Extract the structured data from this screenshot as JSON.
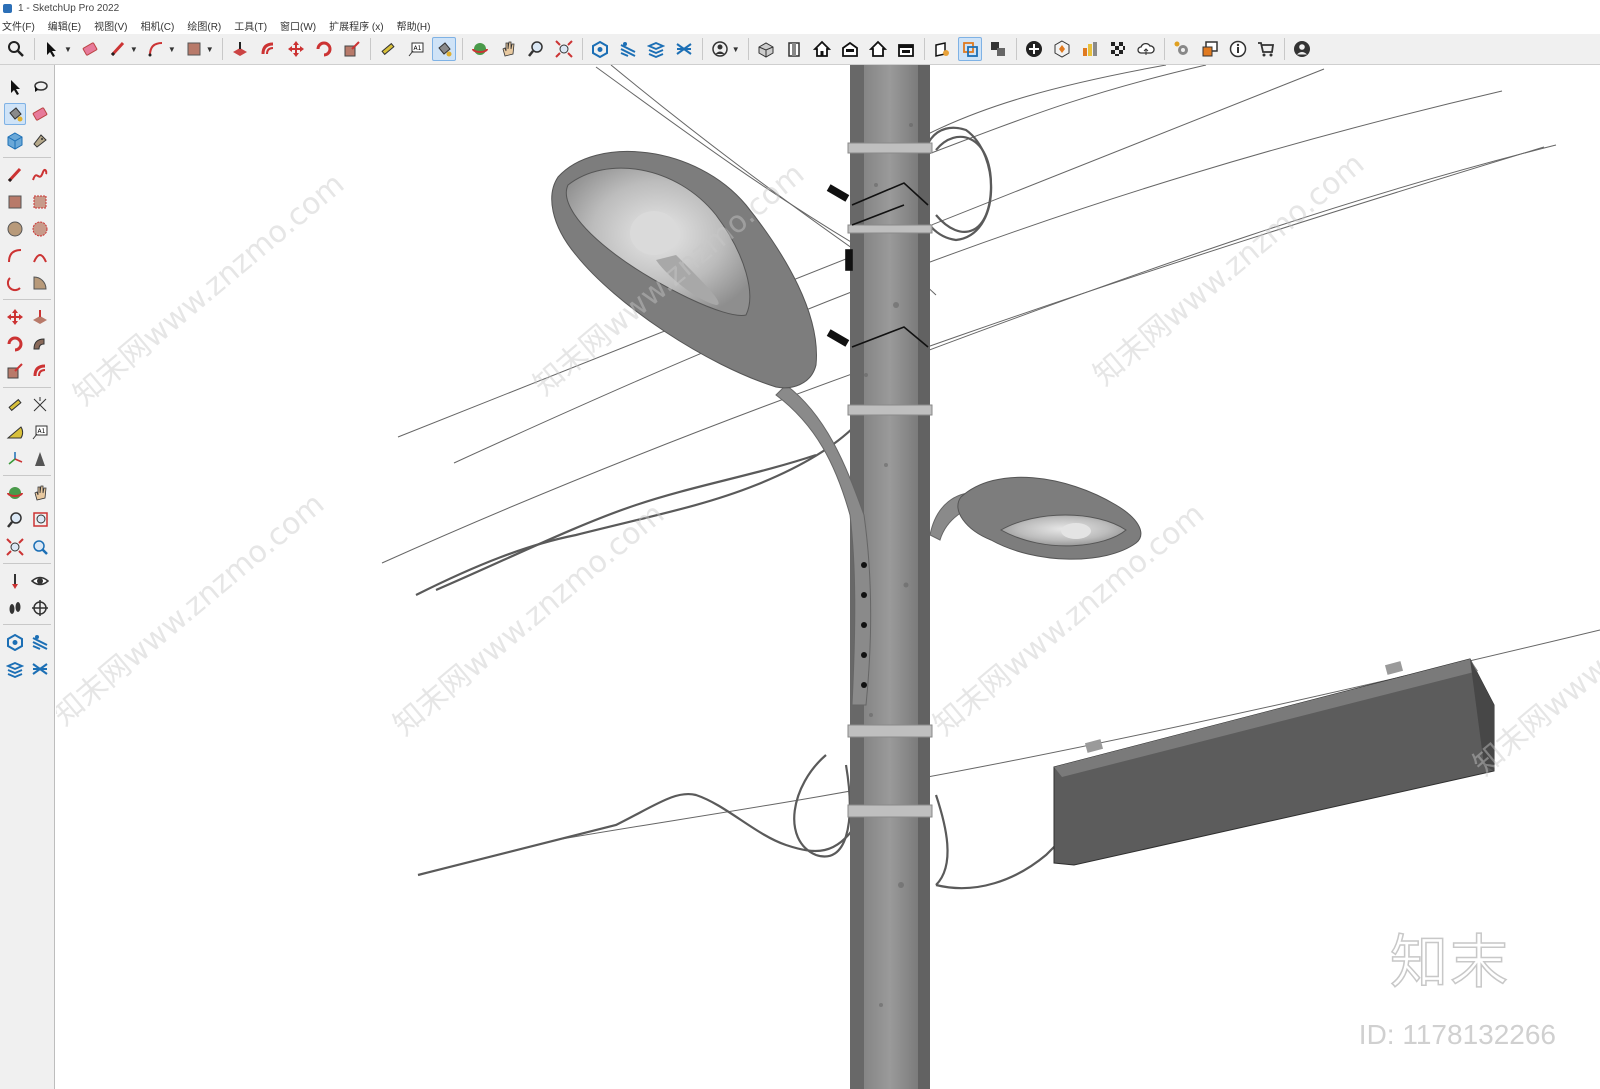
{
  "window": {
    "title": "1 - SketchUp Pro 2022"
  },
  "menu": [
    "文件(F)",
    "编辑(E)",
    "视图(V)",
    "相机(C)",
    "绘图(R)",
    "工具(T)",
    "窗口(W)",
    "扩展程序 (x)",
    "帮助(H)"
  ],
  "toolbar": {
    "groups": [
      [
        "search-icon"
      ],
      [
        "select-arrow-icon",
        "eraser-icon",
        "pencil-icon",
        "arc-icon",
        "rectangle-icon"
      ],
      [
        "push-pull-icon",
        "offset-icon",
        "move-icon",
        "rotate-icon",
        "scale-icon"
      ],
      [
        "tape-measure-icon",
        "text-icon",
        "paint-bucket-icon"
      ],
      [
        "orbit-icon",
        "pan-icon",
        "zoom-icon",
        "zoom-extents-icon"
      ],
      [
        "warehouse-icon",
        "extension-warehouse-icon",
        "layout-icon",
        "style-builder-icon"
      ],
      [
        "user-account-icon"
      ],
      [
        "iso-view-icon",
        "top-view-icon",
        "front-view-icon",
        "right-view-icon",
        "back-view-icon",
        "left-view-icon"
      ],
      [
        "section-plane-icon",
        "section-display-icon",
        "section-fill-icon"
      ],
      [
        "add-location-icon",
        "sandbox-icon",
        "layers-icon",
        "checker-icon",
        "cloud-icon"
      ],
      [
        "settings-icon",
        "components-icon",
        "info-icon",
        "cart-icon",
        "profile-icon"
      ]
    ]
  },
  "watermark": {
    "logo": "知末",
    "id": "ID: 1178132266",
    "diagonal": "知末网www.znzmo.com"
  },
  "colors": {
    "toolbar_bg": "#f0f0f0",
    "pole": "#8a8a8a",
    "sign": "#5c5c5c",
    "lamp": "#7d7d7d",
    "wire": "#666666"
  }
}
